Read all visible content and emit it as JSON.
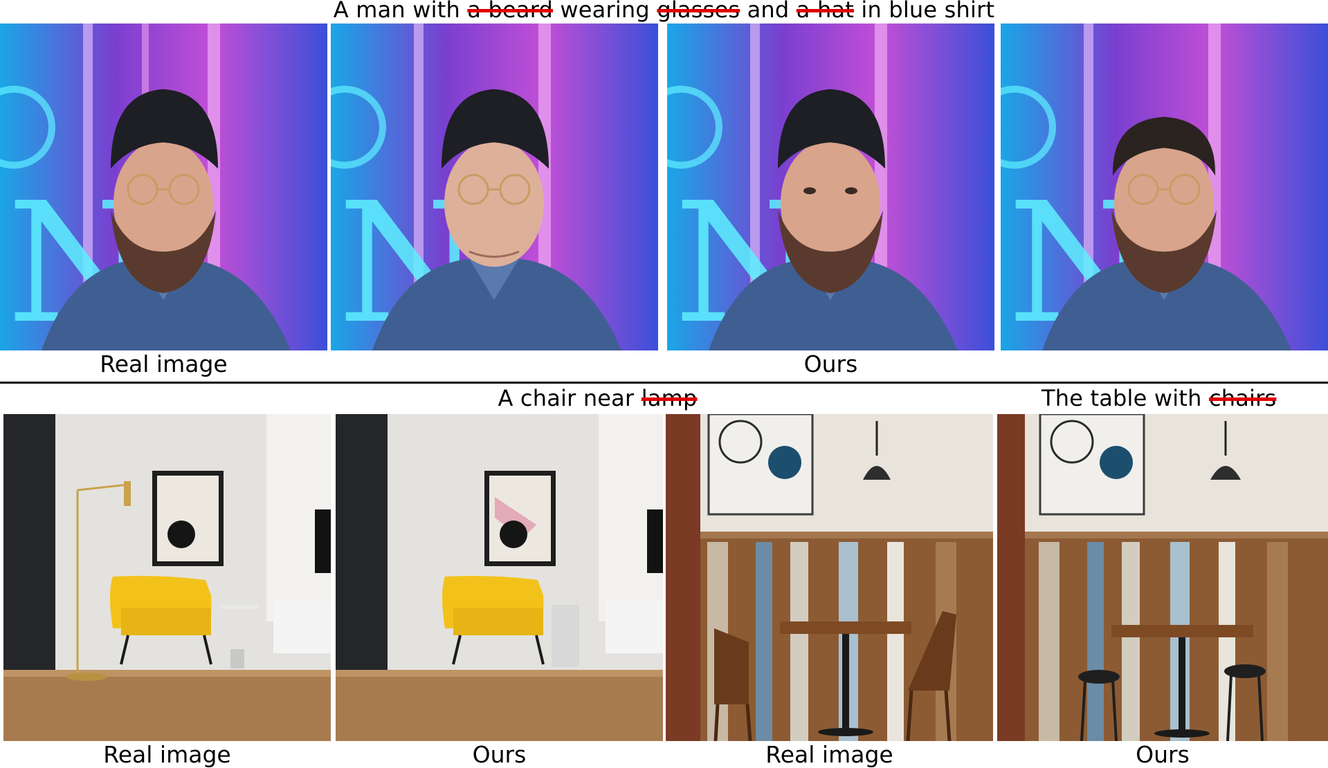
{
  "figure": {
    "top_caption": {
      "p1": "A man with ",
      "s1": "a beard",
      "p2": " wearing ",
      "s2": "glasses",
      "p3": " and ",
      "s3": "a hat",
      "p4": " in blue shirt"
    },
    "top_labels": {
      "real": "Real image",
      "ours": "Ours"
    },
    "bottom_left_caption": {
      "prefix": "A chair near ",
      "struck": "lamp"
    },
    "bottom_right_caption": {
      "prefix": "The table with ",
      "struck": "chairs"
    },
    "bottom_labels": {
      "real_1": "Real image",
      "ours_1": "Ours",
      "real_2": "Real image",
      "ours_2": "Ours"
    },
    "colors": {
      "strike": "#e00000",
      "divider": "#000000",
      "neon_cyan": "#3fd6ff",
      "neon_magenta": "#d24bd8",
      "shirt_blue": "#3f5f92",
      "chair_yellow": "#f3c21a",
      "wood": "#8c5b33"
    },
    "panels": [
      {
        "name": "portrait-real-panel",
        "icon": "man-portrait"
      },
      {
        "name": "portrait-no-beard-panel",
        "icon": "man-portrait"
      },
      {
        "name": "portrait-no-glasses-panel",
        "icon": "man-portrait"
      },
      {
        "name": "portrait-no-hat-panel",
        "icon": "man-portrait"
      },
      {
        "name": "living-room-real-panel",
        "icon": "interior-chair"
      },
      {
        "name": "living-room-ours-panel",
        "icon": "interior-chair"
      },
      {
        "name": "cafe-real-panel",
        "icon": "cafe-table"
      },
      {
        "name": "cafe-ours-panel",
        "icon": "cafe-table"
      }
    ]
  }
}
